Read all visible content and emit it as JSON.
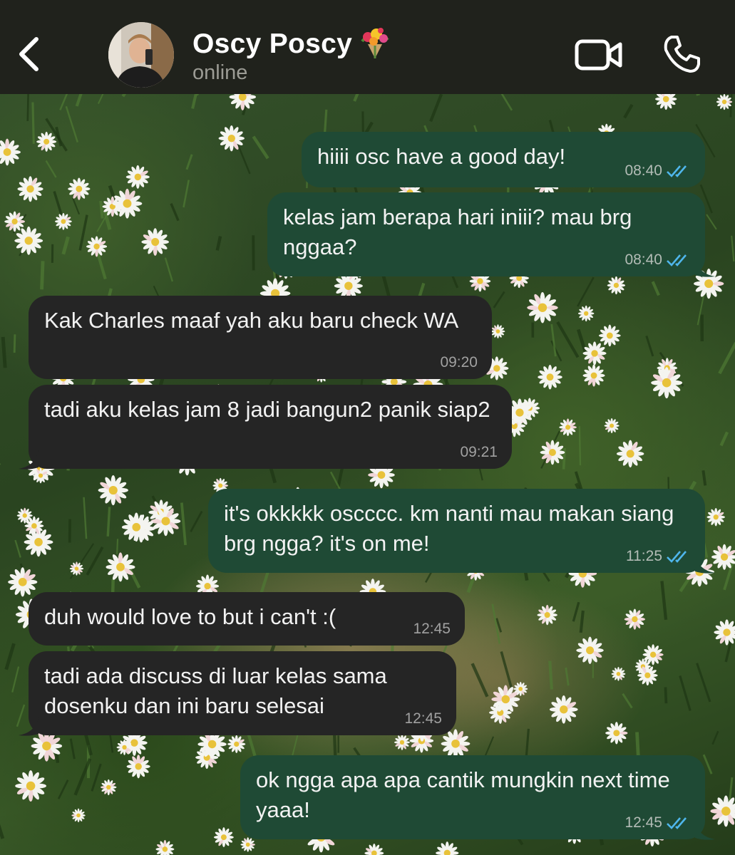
{
  "header": {
    "back_icon": "chevron-left-icon",
    "contact_name": "Oscy Poscy",
    "contact_emoji": "bouquet-icon",
    "status": "online",
    "video_icon": "video-camera-icon",
    "call_icon": "phone-icon"
  },
  "colors": {
    "header_bg": "#20221c",
    "outgoing_bubble": "#1f4a35",
    "incoming_bubble": "#252525",
    "read_tick": "#4fb6ec"
  },
  "messages": [
    {
      "direction": "outgoing",
      "text": "hiiii osc have a good day!",
      "time": "08:40",
      "status": "read"
    },
    {
      "direction": "outgoing",
      "text": "kelas jam berapa hari iniii? mau brg nggaa?",
      "time": "08:40",
      "status": "read"
    },
    {
      "direction": "incoming",
      "text": "Kak Charles maaf yah aku baru check WA",
      "time": "09:20"
    },
    {
      "direction": "incoming",
      "text": "tadi aku kelas jam 8 jadi bangun2 panik siap2",
      "time": "09:21"
    },
    {
      "direction": "outgoing",
      "text": "it's okkkkk oscccc. km nanti mau makan siang brg ngga? it's on me!",
      "time": "11:25",
      "status": "read"
    },
    {
      "direction": "incoming",
      "text": "duh would love to but i can't :(",
      "time": "12:45"
    },
    {
      "direction": "incoming",
      "text": "tadi ada discuss di luar kelas sama dosenku dan ini baru selesai",
      "time": "12:45"
    },
    {
      "direction": "outgoing",
      "text": "ok ngga apa apa cantik mungkin next time yaaa!",
      "time": "12:45",
      "status": "read"
    }
  ]
}
